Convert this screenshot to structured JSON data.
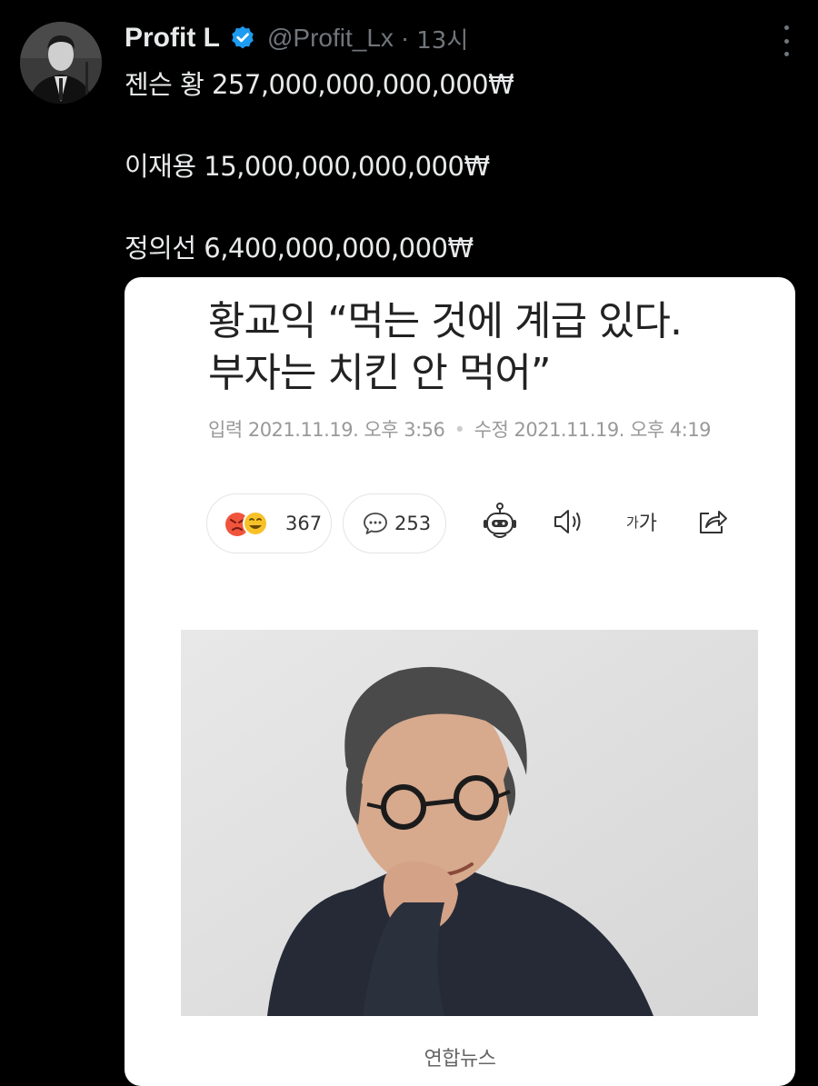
{
  "tweet": {
    "author_name": "Profit L",
    "handle": "@Profit_Lx",
    "separator": "·",
    "time": "13시",
    "lines": [
      "젠슨 황 257,000,000,000,000₩",
      "이재용 15,000,000,000,000₩",
      "정의선 6,400,000,000,000₩"
    ]
  },
  "article": {
    "headline_line1": "황교익 “먹는 것에 계급 있다.",
    "headline_line2": "부자는 치킨 안 먹어”",
    "input_label": "입력",
    "input_date": "2021.11.19. 오후 3:56",
    "edit_label": "수정",
    "edit_date": "2021.11.19. 오후 4:19",
    "reaction_count": "367",
    "comment_count": "253",
    "font_small": "가",
    "font_large": "가",
    "photo_caption": "연합뉴스"
  },
  "colors": {
    "background": "#000000",
    "text": "#e7e9ea",
    "muted": "#71767b",
    "verified": "#1d9bf0",
    "card": "#ffffff"
  },
  "icons": [
    "verified-badge-icon",
    "more-options-icon",
    "angry-emoji-icon",
    "smile-emoji-icon",
    "comment-icon",
    "robot-icon",
    "speaker-icon",
    "share-icon"
  ]
}
